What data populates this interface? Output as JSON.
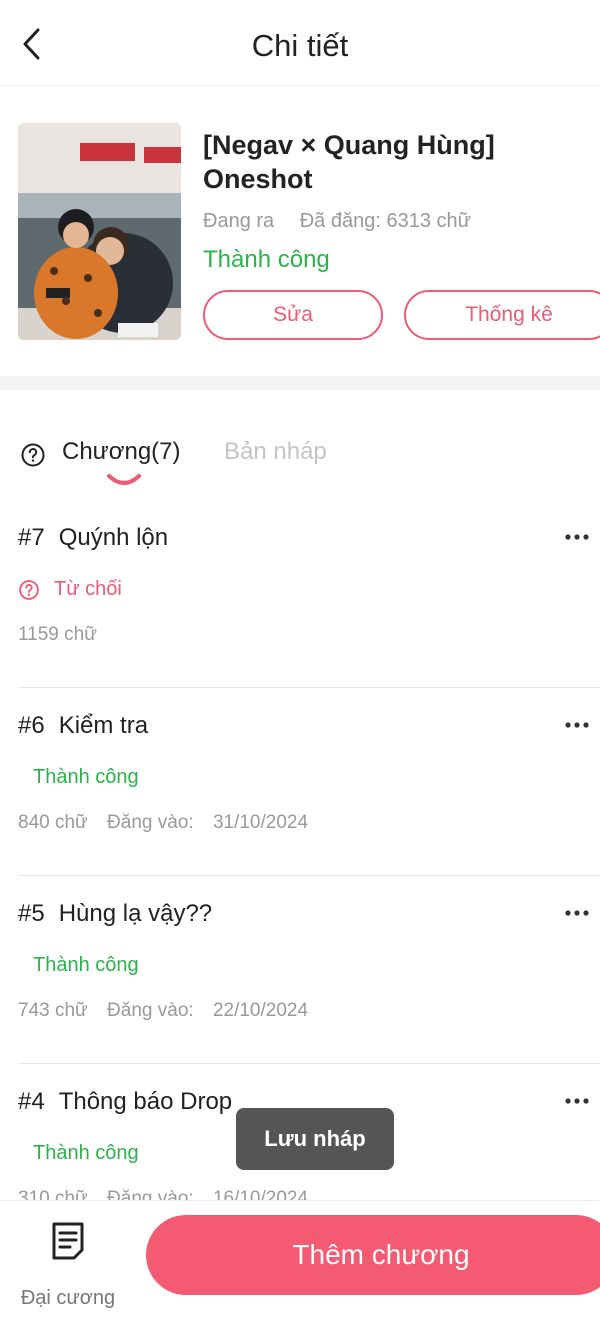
{
  "header": {
    "title": "Chi tiết"
  },
  "story": {
    "title_line1": "[Negav × Quang Hùng]",
    "title_line2": "Oneshot",
    "state": "Đang ra",
    "posted_words": "Đã đăng: 6313 chữ",
    "status": "Thành công",
    "edit_label": "Sửa",
    "stats_label": "Thống kê"
  },
  "tabs": {
    "chapters_label": "Chương(7)",
    "drafts_label": "Bản nháp"
  },
  "chapters": [
    {
      "num": "#7",
      "title": "Quýnh lộn",
      "status": "Từ chối",
      "words": "1159 chữ",
      "posted_label": "",
      "posted_date": ""
    },
    {
      "num": "#6",
      "title": "Kiểm tra",
      "status": "Thành công",
      "words": "840 chữ",
      "posted_label": "Đăng vào:",
      "posted_date": "31/10/2024"
    },
    {
      "num": "#5",
      "title": "Hùng lạ vậy??",
      "status": "Thành công",
      "words": "743 chữ",
      "posted_label": "Đăng vào:",
      "posted_date": "22/10/2024"
    },
    {
      "num": "#4",
      "title": "Thông báo Drop",
      "status": "Thành công",
      "words": "310 chữ",
      "posted_label": "Đăng vào:",
      "posted_date": "16/10/2024"
    }
  ],
  "toast": {
    "text": "Lưu nháp"
  },
  "bottom": {
    "outline_label": "Đại cương",
    "add_chapter_label": "Thêm chương"
  },
  "colors": {
    "accent": "#f45a72",
    "success": "#2bb34a",
    "muted": "#999999"
  }
}
